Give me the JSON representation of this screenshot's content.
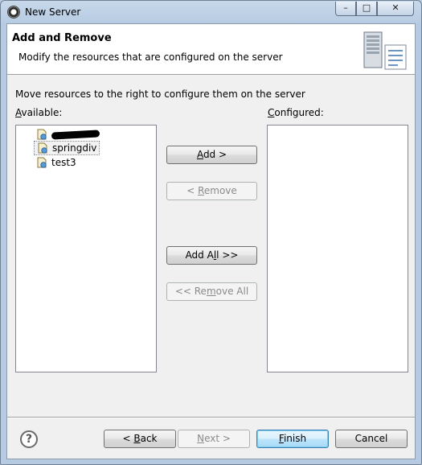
{
  "window": {
    "title": "New Server",
    "controls": {
      "minimize": "–",
      "maximize": "□",
      "close": "✕"
    }
  },
  "banner": {
    "title": "Add and Remove",
    "description": "Modify the resources that are configured on the server",
    "graphic": "server-icon"
  },
  "instruction": "Move resources to the right to configure them on the server",
  "available": {
    "label_first": "A",
    "label_rest": "vailable:",
    "items": [
      {
        "label": "",
        "redacted": true,
        "icon": "web-project-icon"
      },
      {
        "label": "springdiv",
        "selected": true,
        "icon": "web-project-icon"
      },
      {
        "label": "test3",
        "icon": "web-project-icon"
      }
    ]
  },
  "configured": {
    "label_first": "C",
    "label_rest": "onfigured:",
    "items": []
  },
  "buttons": {
    "add": {
      "pre": "",
      "mn": "A",
      "post": "dd >",
      "enabled": true
    },
    "remove": {
      "pre": "< ",
      "mn": "R",
      "post": "emove",
      "enabled": false
    },
    "add_all": {
      "pre": "Add A",
      "mn": "l",
      "post": "l >>",
      "enabled": true
    },
    "remove_all": {
      "pre": "<< Re",
      "mn": "m",
      "post": "ove All",
      "enabled": false
    }
  },
  "footer": {
    "help_icon": "help-icon",
    "help_glyph": "?",
    "back": {
      "pre": "< ",
      "mn": "B",
      "post": "ack",
      "enabled": true
    },
    "next": {
      "pre": "",
      "mn": "N",
      "post": "ext >",
      "enabled": false
    },
    "finish": {
      "pre": "",
      "mn": "F",
      "post": "inish",
      "enabled": true,
      "default": true
    },
    "cancel": {
      "label": "Cancel",
      "enabled": true
    }
  },
  "colors": {
    "title_bar": "#b6cbe2",
    "dialog_bg": "#f0f0f0",
    "default_button_border": "#3c7fb1"
  }
}
